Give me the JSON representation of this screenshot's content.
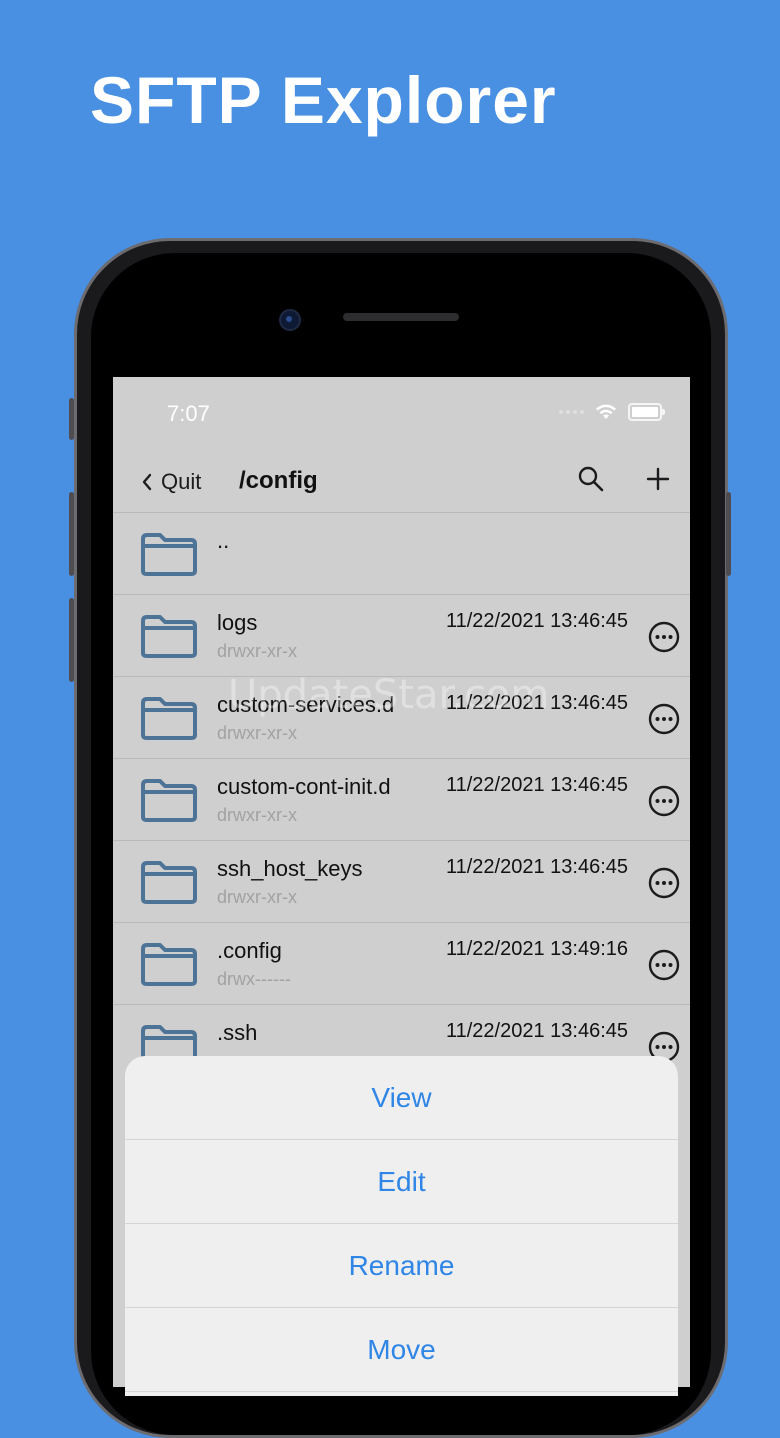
{
  "headline": "SFTP Explorer",
  "status": {
    "time": "7:07"
  },
  "navbar": {
    "back_label": "Quit",
    "title": "/config"
  },
  "rows": [
    {
      "name": "..",
      "perm": "",
      "date": ""
    },
    {
      "name": "logs",
      "perm": "drwxr-xr-x",
      "date": "11/22/2021 13:46:45"
    },
    {
      "name": "custom-services.d",
      "perm": "drwxr-xr-x",
      "date": "11/22/2021 13:46:45"
    },
    {
      "name": "custom-cont-init.d",
      "perm": "drwxr-xr-x",
      "date": "11/22/2021 13:46:45"
    },
    {
      "name": "ssh_host_keys",
      "perm": "drwxr-xr-x",
      "date": "11/22/2021 13:46:45"
    },
    {
      "name": ".config",
      "perm": "drwx------",
      "date": "11/22/2021 13:49:16"
    },
    {
      "name": ".ssh",
      "perm": "",
      "date": "11/22/2021 13:46:45"
    }
  ],
  "action_sheet": {
    "view": "View",
    "edit": "Edit",
    "rename": "Rename",
    "move": "Move"
  },
  "watermark": "UpdateStar.com",
  "colors": {
    "background": "#4a90e2",
    "folder": "#4d7396",
    "action": "#2f86e6"
  }
}
